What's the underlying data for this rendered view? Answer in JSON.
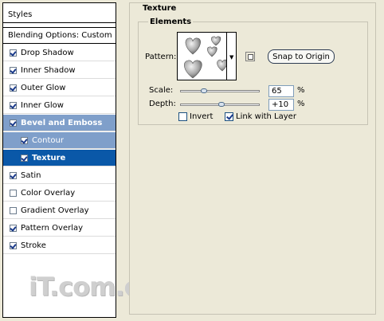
{
  "styles_list": {
    "header": "Styles",
    "blending": "Blending Options: Custom",
    "items": [
      {
        "label": "Drop Shadow",
        "checked": true
      },
      {
        "label": "Inner Shadow",
        "checked": true
      },
      {
        "label": "Outer Glow",
        "checked": true
      },
      {
        "label": "Inner Glow",
        "checked": true
      },
      {
        "label": "Bevel and Emboss",
        "checked": true
      },
      {
        "label": "Contour",
        "checked": true
      },
      {
        "label": "Texture",
        "checked": true
      },
      {
        "label": "Satin",
        "checked": true
      },
      {
        "label": "Color Overlay",
        "checked": false
      },
      {
        "label": "Gradient Overlay",
        "checked": false
      },
      {
        "label": "Pattern Overlay",
        "checked": true
      },
      {
        "label": "Stroke",
        "checked": true
      }
    ]
  },
  "watermark": "iT.com.cn",
  "texture_panel": {
    "title": "Texture",
    "elements_title": "Elements",
    "pattern_label": "Pattern:",
    "snap_button": "Snap to Origin",
    "scale_label": "Scale:",
    "scale_value": "65",
    "scale_unit": "%",
    "depth_label": "Depth:",
    "depth_value": "+10",
    "depth_unit": "%",
    "invert_label": "Invert",
    "invert_checked": false,
    "link_label": "Link with Layer",
    "link_checked": true,
    "scale_fraction": 0.3,
    "depth_fraction": 0.52
  },
  "icons": {
    "pattern_dropdown": "triangle-down-icon",
    "new_preset": "new-preset-icon",
    "pattern_preview": "hearts-pattern"
  }
}
